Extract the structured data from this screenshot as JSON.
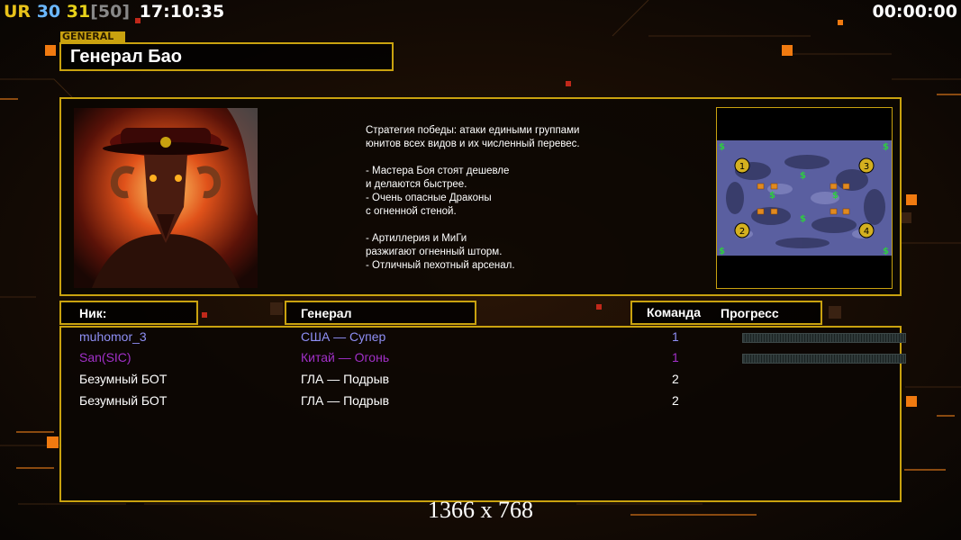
{
  "hud": {
    "ur": "UR",
    "fps_a": "30",
    "fps_b": "31",
    "fps_cap": "[50]",
    "clock": "17:10:35",
    "timer": "00:00:00"
  },
  "general_tag": "GENERAL",
  "general_name": "Генерал Бао",
  "description": [
    "Стратегия победы: атаки едиными группами",
    "юнитов всех видов и их численный перевес.",
    "",
    "- Мастера Боя стоят дешевле",
    "и делаются быстрее.",
    "- Очень опасные Драконы",
    "с огненной стеной.",
    "",
    "- Артиллерия и МиГи",
    "разжигают огненный шторм.",
    "- Отличный пехотный арсенал."
  ],
  "columns": {
    "nick": "Ник:",
    "general": "Генерал",
    "team": "Команда",
    "progress": "Прогресс"
  },
  "players": [
    {
      "nick": "muhomor_3",
      "general": "США — Супер",
      "team": "1",
      "color": "#8f8ff5",
      "progress_bar": true
    },
    {
      "nick": "San(SIC)",
      "general": "Китай — Огонь",
      "team": "1",
      "color": "#a230c8",
      "progress_bar": true
    },
    {
      "nick": "Безумный БОТ",
      "general": "ГЛА — Подрыв",
      "team": "2",
      "color": "#ffffff",
      "progress_bar": false
    },
    {
      "nick": "Безумный БОТ",
      "general": "ГЛА — Подрыв",
      "team": "2",
      "color": "#ffffff",
      "progress_bar": false
    }
  ],
  "map": {
    "start_positions": [
      "1",
      "2",
      "3",
      "4"
    ],
    "resource_symbol": "$"
  },
  "resolution": "1366 x 768",
  "colors": {
    "frame": "#c9a20f",
    "accent_orange": "#f07a10",
    "ur_u": "#e8c21a",
    "ur_r": "#3ec63e",
    "fps_a": "#6bb8ff",
    "fps_b": "#e8d21a",
    "fps_cap": "#888888"
  }
}
